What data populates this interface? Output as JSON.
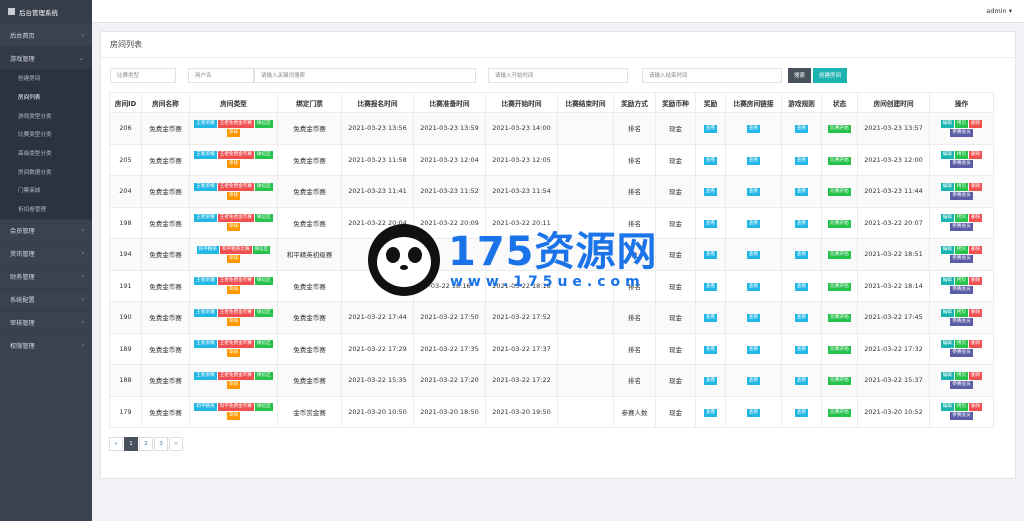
{
  "brand": "后台管理系统",
  "user": "admin",
  "menu": [
    {
      "label": "后台首页",
      "arrow": "›",
      "open": false
    },
    {
      "label": "游戏管理",
      "arrow": "⌄",
      "open": true,
      "children": [
        "创建房间",
        "房间列表",
        "游戏类型分类",
        "比赛类型分类",
        "高级类型分类",
        "房间数据分类",
        "门票商城",
        "折扣卷管理"
      ],
      "active_child": 1
    },
    {
      "label": "会员管理",
      "arrow": "›",
      "open": false
    },
    {
      "label": "资讯管理",
      "arrow": "›",
      "open": false
    },
    {
      "label": "财务管理",
      "arrow": "›",
      "open": false
    },
    {
      "label": "系统配置",
      "arrow": "›",
      "open": false
    },
    {
      "label": "审核管理",
      "arrow": "›",
      "open": false
    },
    {
      "label": "权限管理",
      "arrow": "›",
      "open": false
    }
  ],
  "page_title": "房间列表",
  "filters": {
    "match_type": "比赛类型",
    "username": "用户名",
    "keyword_placeholder": "请输入关键词搜索",
    "start_placeholder": "请输入开始时间",
    "end_placeholder": "请输入结束时间",
    "search_label": "搜索",
    "create_label": "创建房间"
  },
  "columns": [
    "房间ID",
    "房间名称",
    "房间类型",
    "绑定门票",
    "比赛报名时间",
    "比赛准备时间",
    "比赛开始时间",
    "比赛结束时间",
    "奖励方式",
    "奖励币种",
    "奖励",
    "比赛房间链接",
    "游戏规则",
    "状态",
    "房间创建时间",
    "操作"
  ],
  "row_labels": {
    "view": "查看",
    "status": "比赛开始",
    "edit": "编辑",
    "copy": "拷贝",
    "delete": "删除",
    "members": "参赛会员"
  },
  "rows": [
    {
      "id": "206",
      "name": "免费金币赛",
      "types": [
        [
          "王者荣耀",
          "t-blue"
        ],
        [
          "王者免费金币赛",
          "t-red"
        ],
        [
          "微信区",
          "t-green"
        ],
        [
          "单排",
          "t-orange"
        ]
      ],
      "ticket": "免费金币赛",
      "signup": "2021-03-23 13:56",
      "prepare": "2021-03-23 13:59",
      "start": "2021-03-23 14:00",
      "end": "",
      "reward_way": "排名",
      "currency": "现金",
      "created": "2021-03-23 13:57"
    },
    {
      "id": "205",
      "name": "免费金币赛",
      "types": [
        [
          "王者荣耀",
          "t-blue"
        ],
        [
          "王者免费金币赛",
          "t-red"
        ],
        [
          "微信区",
          "t-green"
        ],
        [
          "单排",
          "t-orange"
        ]
      ],
      "ticket": "免费金币赛",
      "signup": "2021-03-23 11:58",
      "prepare": "2021-03-23 12:04",
      "start": "2021-03-23 12:05",
      "end": "",
      "reward_way": "排名",
      "currency": "现金",
      "created": "2021-03-23 12:00"
    },
    {
      "id": "204",
      "name": "免费金币赛",
      "types": [
        [
          "王者荣耀",
          "t-blue"
        ],
        [
          "王者免费金币赛",
          "t-red"
        ],
        [
          "微信区",
          "t-green"
        ],
        [
          "单排",
          "t-orange"
        ]
      ],
      "ticket": "免费金币赛",
      "signup": "2021-03-23 11:41",
      "prepare": "2021-03-23 11:52",
      "start": "2021-03-23 11:54",
      "end": "",
      "reward_way": "排名",
      "currency": "现金",
      "created": "2021-03-23 11:44"
    },
    {
      "id": "198",
      "name": "免费金币赛",
      "types": [
        [
          "王者荣耀",
          "t-blue"
        ],
        [
          "王者免费金币赛",
          "t-red"
        ],
        [
          "微信区",
          "t-green"
        ],
        [
          "单排",
          "t-orange"
        ]
      ],
      "ticket": "免费金币赛",
      "signup": "2021-03-22 20:04",
      "prepare": "2021-03-22 20:09",
      "start": "2021-03-22 20:11",
      "end": "",
      "reward_way": "排名",
      "currency": "现金",
      "created": "2021-03-22 20:07"
    },
    {
      "id": "194",
      "name": "免费金币赛",
      "types": [
        [
          "和平精英",
          "t-blue"
        ],
        [
          "和平精英比赛",
          "t-red"
        ],
        [
          "微信区",
          "t-green"
        ],
        [
          "单排",
          "t-orange"
        ]
      ],
      "ticket": "和平精英初级赛",
      "signup": "2021",
      "prepare": "",
      "start": "",
      "end": "",
      "reward_way": "数",
      "currency": "现金",
      "created": "2021-03-22 18:51"
    },
    {
      "id": "191",
      "name": "免费金币赛",
      "types": [
        [
          "王者荣耀",
          "t-blue"
        ],
        [
          "王者免费金币赛",
          "t-red"
        ],
        [
          "微信区",
          "t-green"
        ],
        [
          "单排",
          "t-orange"
        ]
      ],
      "ticket": "免费金币赛",
      "signup": "",
      "prepare": "-03-22 18:16",
      "start": "2021-03-22 18:18",
      "end": "",
      "reward_way": "排名",
      "currency": "现金",
      "created": "2021-03-22 18:14"
    },
    {
      "id": "190",
      "name": "免费金币赛",
      "types": [
        [
          "王者荣耀",
          "t-blue"
        ],
        [
          "王者免费金币赛",
          "t-red"
        ],
        [
          "微信区",
          "t-green"
        ],
        [
          "单排",
          "t-orange"
        ]
      ],
      "ticket": "免费金币赛",
      "signup": "2021-03-22 17:44",
      "prepare": "2021-03-22 17:50",
      "start": "2021-03-22 17:52",
      "end": "",
      "reward_way": "排名",
      "currency": "现金",
      "created": "2021-03-22 17:45"
    },
    {
      "id": "189",
      "name": "免费金币赛",
      "types": [
        [
          "王者荣耀",
          "t-blue"
        ],
        [
          "王者免费金币赛",
          "t-red"
        ],
        [
          "微信区",
          "t-green"
        ],
        [
          "单排",
          "t-orange"
        ]
      ],
      "ticket": "免费金币赛",
      "signup": "2021-03-22 17:29",
      "prepare": "2021-03-22 17:35",
      "start": "2021-03-22 17:37",
      "end": "",
      "reward_way": "排名",
      "currency": "现金",
      "created": "2021-03-22 17:32"
    },
    {
      "id": "188",
      "name": "免费金币赛",
      "types": [
        [
          "王者荣耀",
          "t-blue"
        ],
        [
          "王者免费金币赛",
          "t-red"
        ],
        [
          "微信区",
          "t-green"
        ],
        [
          "单排",
          "t-orange"
        ]
      ],
      "ticket": "免费金币赛",
      "signup": "2021-03-22 15:35",
      "prepare": "2021-03-22 17:20",
      "start": "2021-03-22 17:22",
      "end": "",
      "reward_way": "排名",
      "currency": "现金",
      "created": "2021-03-22 15:37"
    },
    {
      "id": "179",
      "name": "免费金币赛",
      "types": [
        [
          "和平精英",
          "t-blue"
        ],
        [
          "和平免费金币赛",
          "t-red"
        ],
        [
          "微信区",
          "t-green"
        ],
        [
          "单排",
          "t-orange"
        ]
      ],
      "ticket": "金币赏金赛",
      "signup": "2021-03-20 10:50",
      "prepare": "2021-03-20 18:50",
      "start": "2021-03-20 19:50",
      "end": "",
      "reward_way": "参赛人数",
      "currency": "现金",
      "created": "2021-03-20 10:52"
    }
  ],
  "pager": [
    "«",
    "1",
    "2",
    "3",
    "»"
  ],
  "pager_active": 1,
  "watermark": {
    "big": "175资源网",
    "small": "www.175ue.com"
  }
}
